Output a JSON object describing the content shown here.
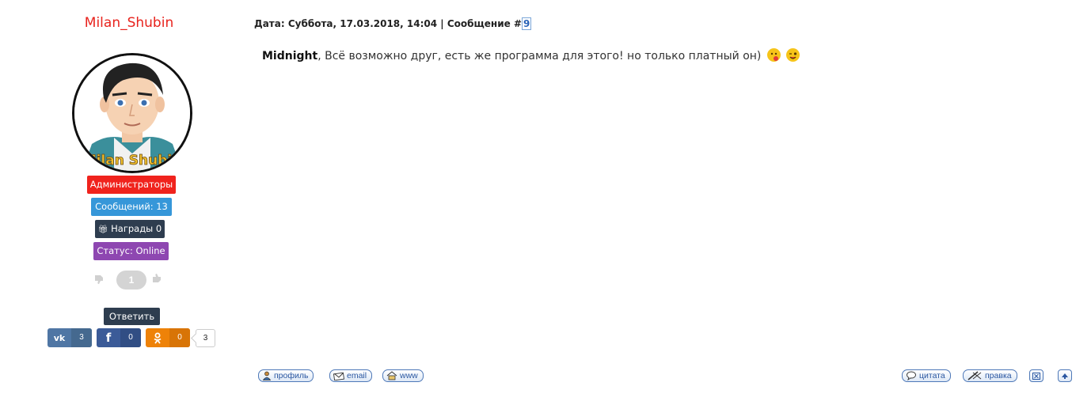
{
  "user": {
    "name": "Milan_Shubin",
    "avatar_text": "Milan Shubin",
    "group_badge": "Администраторы",
    "posts_badge": "Сообщений: 13",
    "awards_badge": "Награды 0",
    "status_badge": "Статус: Online",
    "reputation": "1",
    "reply_label": "Ответить"
  },
  "share": {
    "vk": {
      "icon": "vk-icon",
      "count": "3"
    },
    "facebook": {
      "icon": "facebook-icon",
      "count": "0"
    },
    "odnoklassniki": {
      "icon": "odnoklassniki-icon",
      "count": "0"
    },
    "total": "3"
  },
  "post": {
    "meta_prefix": "Дата: Суббота, 17.03.2018, 14:04 | Сообщение #",
    "number": "9",
    "addressee": "Midnight",
    "text": ", Всё возможно друг, есть же программа для этого! но только платный он)"
  },
  "actions": {
    "profile": "профиль",
    "email": "email",
    "www": "www",
    "quote": "цитата",
    "edit": "правка"
  },
  "colors": {
    "username": "#e8231d",
    "admin": "#f0231d",
    "posts": "#3697d9",
    "awards": "#2e3d4f",
    "status": "#8e47b1"
  }
}
